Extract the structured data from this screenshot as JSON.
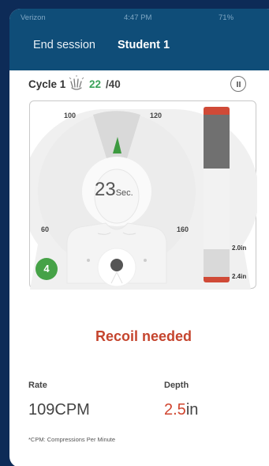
{
  "status_bar": {
    "carrier": "Verizon",
    "time": "4:47 PM",
    "battery": "71%"
  },
  "nav": {
    "end_session": "End session",
    "title": "Student 1"
  },
  "cycle": {
    "label": "Cycle 1",
    "count": "22",
    "total": "/40"
  },
  "gauge": {
    "labels": {
      "l100": "100",
      "l120": "120",
      "l60": "60",
      "l160": "160"
    },
    "timer_value": "23",
    "timer_unit": "Sec.",
    "badge": "4"
  },
  "depth_scale": {
    "mark_top": "2.0in",
    "mark_bottom": "2.4in"
  },
  "feedback": "Recoil needed",
  "metrics": {
    "rate_label": "Rate",
    "rate_value": "109CPM",
    "depth_label": "Depth",
    "depth_value": "2.5",
    "depth_unit": "in"
  },
  "footnote": "*CPM: Compressions Per Minute",
  "colors": {
    "navbar": "#0f4d78",
    "background": "#0d2b57",
    "good": "#3ba35a",
    "alert": "#c5452e",
    "badge": "#46a247"
  },
  "icons": [
    "signal-icon",
    "wifi-icon",
    "location-icon",
    "battery-icon",
    "compression-hand-icon",
    "pause-icon"
  ]
}
